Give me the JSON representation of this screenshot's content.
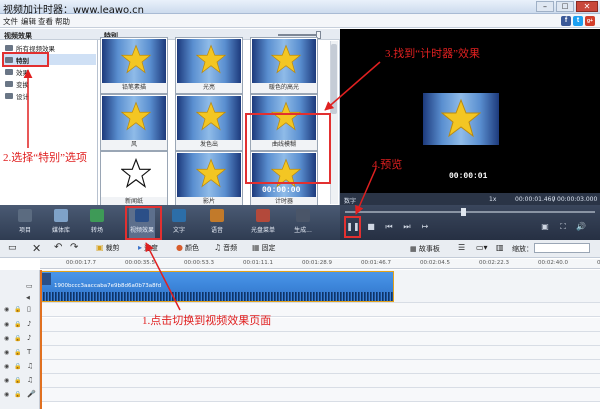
{
  "window": {
    "title": "视频加计时器：www.leawo.cn",
    "social": [
      "f",
      "t",
      "g+"
    ]
  },
  "menu": [
    "文件",
    "编辑",
    "查看",
    "帮助"
  ],
  "sidebar": {
    "header": "视频效果",
    "items": [
      "所有视频效果",
      "特别",
      "效果",
      "变换",
      "设计"
    ]
  },
  "effects": {
    "header": "特别",
    "tiles": [
      "铅笔素描",
      "光亮",
      "暖色的高光",
      "风",
      "发色出",
      "曲线模糊",
      "新闻纸",
      "影片",
      "计时器"
    ],
    "timer_text": "00:00:00"
  },
  "preview": {
    "time": "00:00:01",
    "label": "数字",
    "speed": "1x",
    "current": "00:00:01.460",
    "total": "00:00:03.000"
  },
  "toolbar": [
    "项目",
    "媒体库",
    "转场",
    "视频效果",
    "文字",
    "语音",
    "光盘菜单",
    "生成..."
  ],
  "timeline": {
    "tools": [
      "裁剪",
      "速度",
      "颜色",
      "音频",
      "固定"
    ],
    "storyboard": "故事板",
    "zoom_label": "缩放："
  },
  "ruler": [
    "00:00:17.7",
    "00:00:35.5",
    "00:00:53.3",
    "00:01:11.1",
    "00:01:28.9",
    "00:01:46.7",
    "00:02:04.5",
    "00:02:22.3",
    "00:02:40.0",
    "00:02:57.8"
  ],
  "clip": {
    "name": "1900bccc3aaccaba7e9b8d6a0b73a8fd"
  },
  "annotations": {
    "a1": "1.点击切换到视频效果页面",
    "a2": "2.选择“特别”选项",
    "a3": "3.找到“计时器”效果",
    "a4": "4.预览"
  },
  "colors": {
    "annotation": "#e02020",
    "toolbar": "#2f3c52",
    "clip": "#3f8be0"
  }
}
